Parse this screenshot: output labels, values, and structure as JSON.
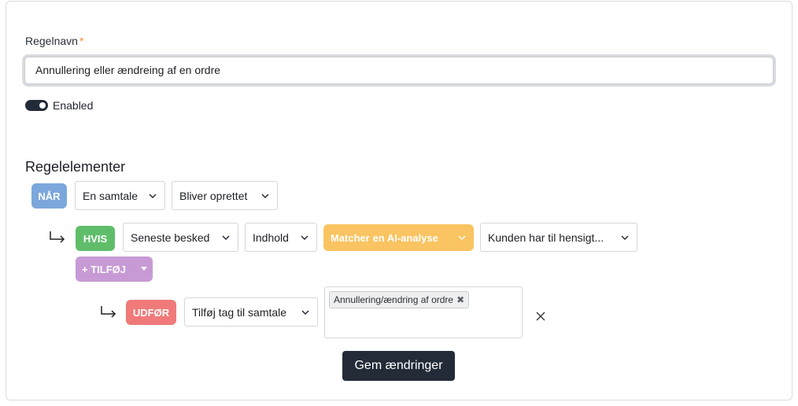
{
  "form": {
    "name_label": "Regelnavn",
    "required_mark": "*",
    "name_value": "Annullering eller ændreing af en ordre",
    "enabled_label": "Enabled",
    "enabled": true
  },
  "rules": {
    "title": "Regelelementer",
    "when": {
      "badge": "NÅR",
      "badge_color": "#7ba7dc",
      "select1": "En samtale",
      "select2": "Bliver oprettet"
    },
    "if": {
      "badge": "HVIS",
      "badge_color": "#5fbd6a",
      "select1": "Seneste besked",
      "select2": "Indhold",
      "select3": "Matcher en AI-analyse",
      "select3_color": "#f9c461",
      "select4": "Kunden har til hensigt..."
    },
    "add": {
      "label": "+ TILFØJ",
      "color": "#c79ad6"
    },
    "do": {
      "badge": "UDFØR",
      "badge_color": "#f07a7a",
      "select1": "Tilføj tag til samtale",
      "tags": [
        "Annullering/ændring af ordre"
      ]
    }
  },
  "actions": {
    "save_label": "Gem ændringer"
  },
  "icons": {
    "chevron": "chevron-down-icon",
    "arrow": "return-arrow-icon",
    "close": "close-icon",
    "tag_remove": "x-icon"
  }
}
